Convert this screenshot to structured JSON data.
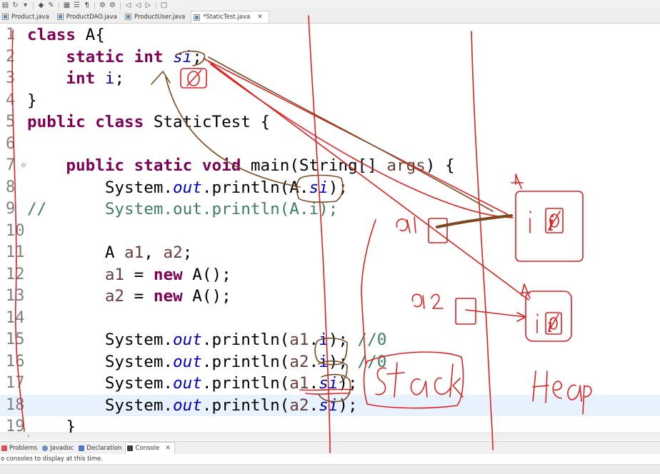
{
  "toolbar": {
    "icons": [
      "open-folder-icon",
      "refresh-icon",
      "run-dropdown-icon",
      "pin-icon",
      "annotation-icon",
      "grid-icon",
      "list-icon",
      "paragraph-icon",
      "tools-icon",
      "tools-icon",
      "back-icon",
      "back-icon",
      "forward-icon",
      "new-window-icon"
    ]
  },
  "editor_tabs": [
    {
      "label": "Product.java",
      "active": false
    },
    {
      "label": "ProductDAO.java",
      "active": false
    },
    {
      "label": "ProductUser.java",
      "active": false
    },
    {
      "label": "*StaticTest.java",
      "active": true,
      "close": "✕"
    }
  ],
  "code": {
    "line_numbers": [
      "1",
      "2",
      "3",
      "4",
      "5",
      "6",
      "7",
      "8",
      "9",
      "10",
      "11",
      "12",
      "13",
      "14",
      "15",
      "16",
      "17",
      "18",
      "19"
    ],
    "fold_marker": "⊖",
    "highlighted_line": 18
  },
  "scroll_arrow": "‹",
  "bottom_panel": {
    "tabs": [
      {
        "label": "Problems",
        "icon": "problems-icon",
        "color": "#d9534f"
      },
      {
        "label": "Javadoc",
        "icon": "at-sign-icon",
        "color": "#6a8fc0"
      },
      {
        "label": "Declaration",
        "icon": "declaration-icon",
        "color": "#4a7db8"
      },
      {
        "label": "Console",
        "icon": "console-icon",
        "color": "#3d3d3d",
        "active": true,
        "close": "✕"
      }
    ],
    "message": "o consoles to display at this time."
  },
  "annotations": {
    "stack_label": "Stack",
    "heap_label": "Heap",
    "a1_label": "a1",
    "a2_label": "a2",
    "class_label_1": "A",
    "class_label_2": "A",
    "field_i": "i",
    "zero_value": "Ø",
    "ink_color": "#e02020",
    "brown_ink_color": "#7a4a1e"
  },
  "colors": {
    "keyword": "#7f0055",
    "comment": "#3f7f5f",
    "static_field": "#0000c0",
    "local_var": "#6a3e3e",
    "line_number": "#7f7f7f",
    "highlight": "#e8f2fe"
  }
}
